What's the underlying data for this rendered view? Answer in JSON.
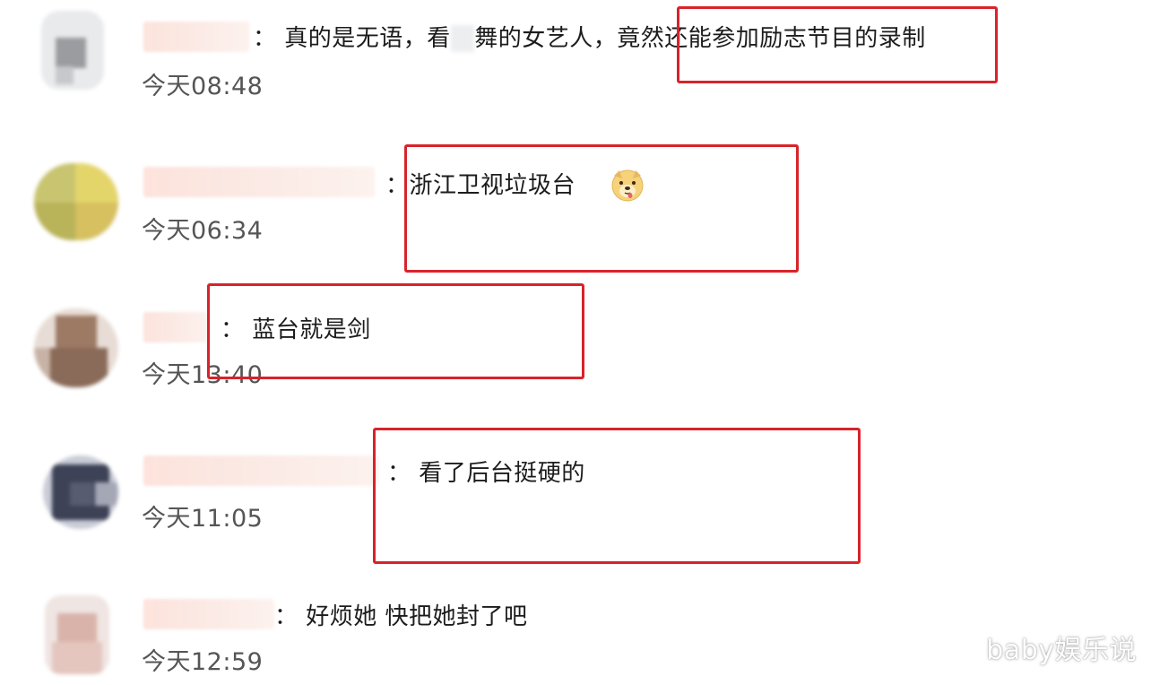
{
  "comments": [
    {
      "text_before": "：  真的是无语，看",
      "redacted": "跳",
      "text_after": "舞的女艺人，",
      "highlighted": "竟然还能参加励志节目的录制",
      "time": "今天08:48"
    },
    {
      "text": "：浙江卫视垃圾台",
      "emoji_name": "dog-face-emoji",
      "time": "今天06:34"
    },
    {
      "text": "：  蓝台就是剑",
      "time": "今天13:40"
    },
    {
      "text": "：  看了后台挺硬的",
      "time": "今天11:05"
    },
    {
      "text": "：  好烦她  快把她封了吧",
      "time": "今天12:59"
    }
  ],
  "watermark": "baby娱乐说",
  "colors": {
    "highlight_border": "#d8232a",
    "timestamp": "#555555",
    "name_blur": "#fbe5df"
  }
}
